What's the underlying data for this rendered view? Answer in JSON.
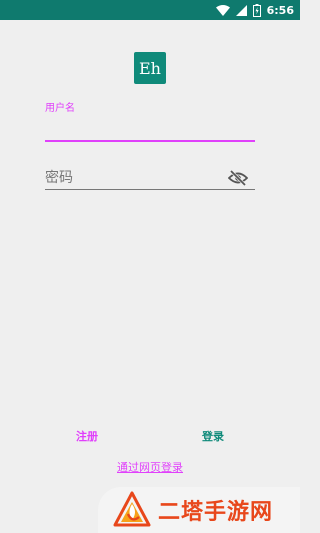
{
  "status_bar": {
    "time": "6:56",
    "icons": [
      "wifi-icon",
      "signal-icon",
      "battery-icon"
    ]
  },
  "app": {
    "logo_text": "Eh",
    "accent_color": "#e040fb",
    "primary_color": "#0f8a7a"
  },
  "login_form": {
    "username_label": "用户名",
    "username_value": "",
    "password_placeholder": "密码",
    "visibility_icon": "visibility-off-icon"
  },
  "actions": {
    "register_label": "注册",
    "signin_label": "登录",
    "web_login_label": "通过网页登录"
  },
  "watermark": {
    "text": "二塔手游网"
  }
}
